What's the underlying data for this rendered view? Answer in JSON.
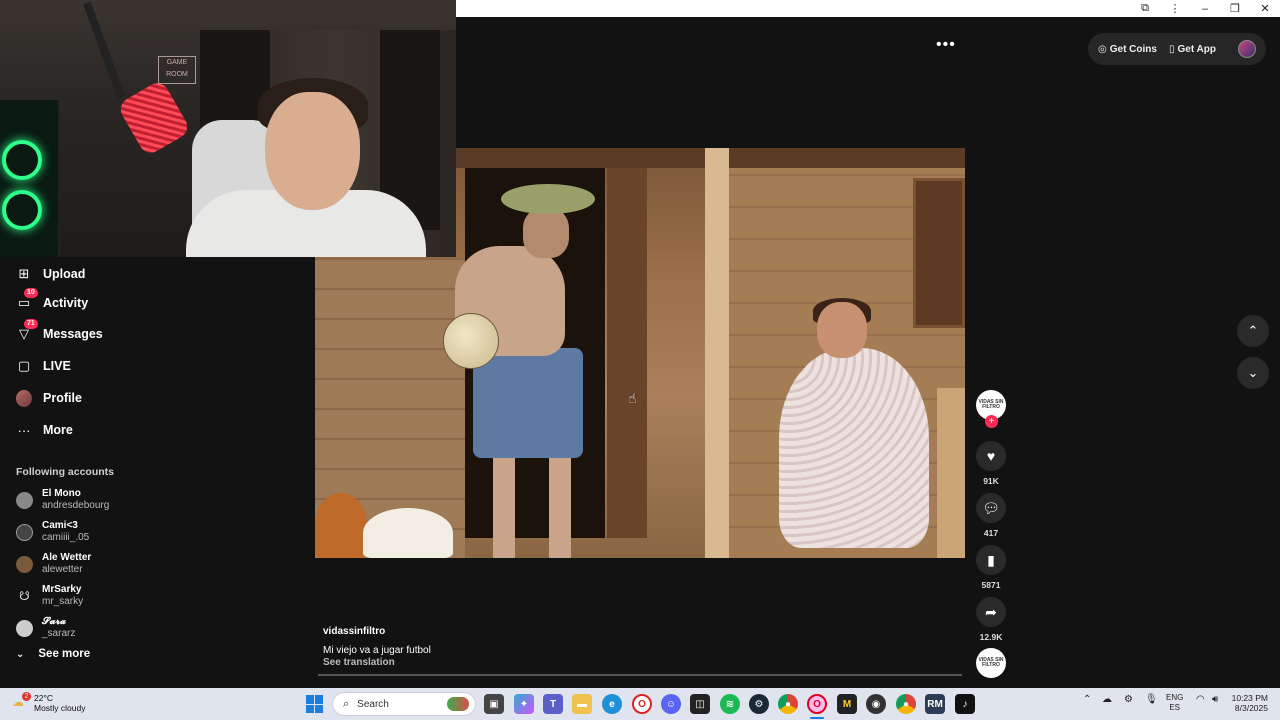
{
  "browser": {
    "extension_icon": "puzzle-icon",
    "menu_icon": "kebab-icon",
    "minimize": "–",
    "restore": "❐",
    "close": "✕"
  },
  "webcam": {
    "poster_text": "GAME ROOM"
  },
  "sidebar": {
    "nav": [
      {
        "label": "Upload",
        "icon": "upload-icon"
      },
      {
        "label": "Activity",
        "icon": "inbox-icon",
        "badge": "10"
      },
      {
        "label": "Messages",
        "icon": "send-icon",
        "badge": "71"
      },
      {
        "label": "LIVE",
        "icon": "live-icon"
      },
      {
        "label": "Profile",
        "icon": "avatar"
      },
      {
        "label": "More",
        "icon": "more-icon"
      }
    ],
    "following_title": "Following accounts",
    "accounts": [
      {
        "name": "El Mono",
        "handle": "andresdebourg"
      },
      {
        "name": "Cami<3",
        "handle": "camiiii_.05"
      },
      {
        "name": "Ale Wetter",
        "handle": "alewetter"
      },
      {
        "name": "MrSarky",
        "handle": "mr_sarky"
      },
      {
        "name": "𝓢𝓪𝓻𝓪",
        "handle": "_sararz"
      }
    ],
    "see_more": "See more"
  },
  "header": {
    "more_dots": "•••",
    "get_coins": "Get Coins",
    "get_app": "Get App"
  },
  "video": {
    "username": "vidassinfiltro",
    "description": "Mi viejo va a jugar futbol",
    "see_translation": "See translation",
    "creator_avatar_text": "VIDAS SIN FILTRO",
    "follow_plus": "+"
  },
  "actions": {
    "likes": "91K",
    "comments": "417",
    "saves": "5871",
    "shares": "12.9K"
  },
  "taskbar": {
    "temperature": "22°C",
    "weather": "Mostly cloudy",
    "weather_badge": "2",
    "search_placeholder": "Search",
    "lang_line1": "ENG",
    "lang_line2": "ES",
    "time": "10:23 PM",
    "date": "8/3/2025",
    "apps": [
      "task-view",
      "copilot",
      "teams",
      "file-explorer",
      "edge",
      "opera",
      "discord",
      "capcut",
      "spotify",
      "steam",
      "chrome",
      "opera-gx-active",
      "cmd",
      "obs",
      "chrome-alt",
      "rm",
      "tiktok"
    ]
  },
  "colors": {
    "accent": "#fe2c55",
    "background": "#121212",
    "taskbar": "#dfe4ee"
  }
}
